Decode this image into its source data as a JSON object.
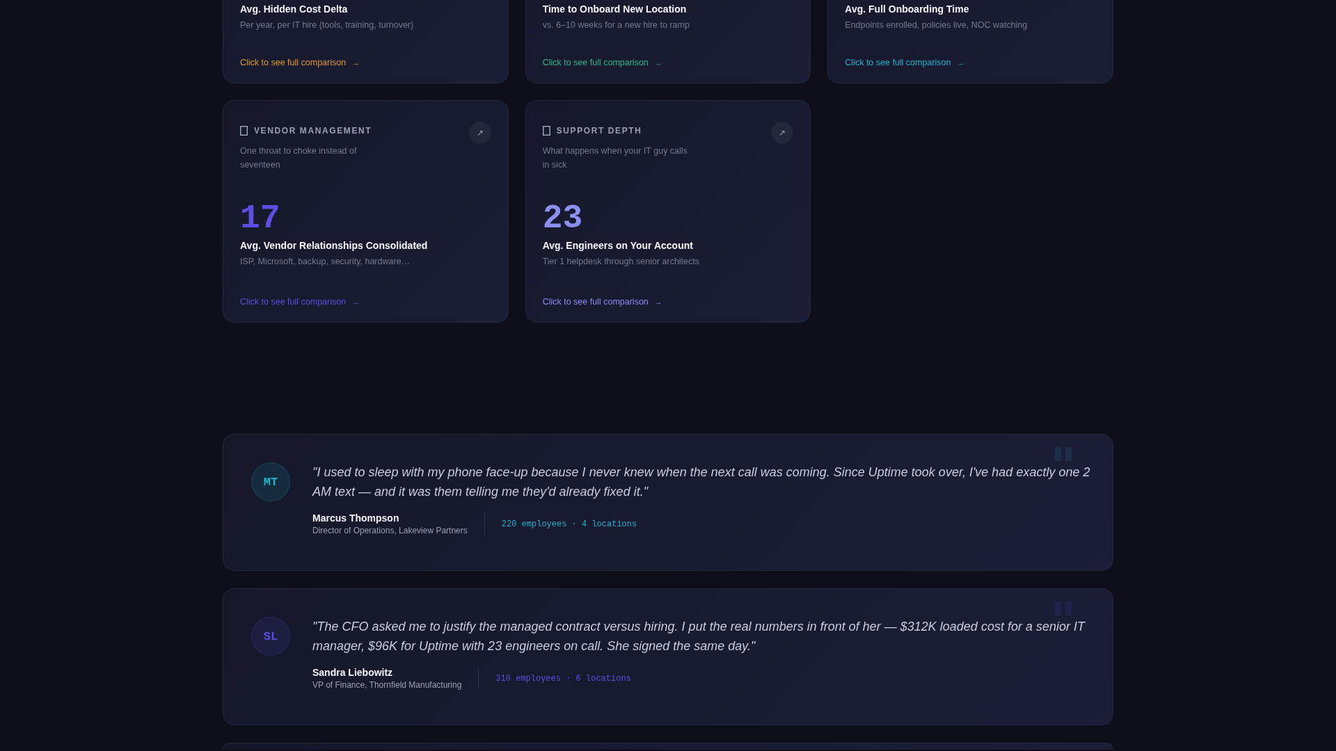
{
  "stat_cards": [
    {
      "title": "Avg. Hidden Cost Delta",
      "description": "Per year, per IT hire (tools, training, turnover)",
      "link": "Click to see full comparison",
      "arrow": "→",
      "color": "#e39a2b"
    },
    {
      "title": "Time to Onboard New Location",
      "description": "vs. 6–10 weeks for a new hire to ramp",
      "link": "Click to see full comparison",
      "arrow": "→",
      "color": "#2bb98a"
    },
    {
      "title": "Avg. Full Onboarding Time",
      "description": "Endpoints enrolled, policies live, NOC watching",
      "link": "Click to see full comparison",
      "arrow": "→",
      "color": "#22b3cc"
    },
    {
      "category": "VENDOR MANAGEMENT",
      "expand": "↗",
      "description": "One throat to choke instead of seventeen",
      "value": "17",
      "title": "Avg. Vendor Relationships Consolidated",
      "detail": "ISP, Microsoft, backup, security, hardware…",
      "link": "Click to see full comparison",
      "arrow": "→",
      "color": "#5b4ee0"
    },
    {
      "category": "SUPPORT DEPTH",
      "expand": "↗",
      "description": "What happens when your IT guy calls in sick",
      "value": "23",
      "title": "Avg. Engineers on Your Account",
      "detail": "Tier 1 helpdesk through senior architects",
      "link": "Click to see full comparison",
      "arrow": "→",
      "color": "#8b8ff2"
    }
  ],
  "testimonials": [
    {
      "initials": "MT",
      "quote": "\"I used to sleep with my phone face-up because I never knew when the next call was coming. Since Uptime took over, I've had exactly one 2 AM text — and it was them telling me they'd already fixed it.\"",
      "name": "Marcus Thompson",
      "role": "Director of Operations, Lakeview Partners",
      "stats": "220 employees · 4 locations",
      "color": "#22b3cc"
    },
    {
      "initials": "SL",
      "quote": "\"The CFO asked me to justify the managed contract versus hiring. I put the real numbers in front of her — $312K loaded cost for a senior IT manager, $96K for Uptime with 23 engineers on call. She signed the same day.\"",
      "name": "Sandra Liebowitz",
      "role": "VP of Finance, Thornfield Manufacturing",
      "stats": "310 employees · 6 locations",
      "color": "#5b4ee0"
    }
  ]
}
